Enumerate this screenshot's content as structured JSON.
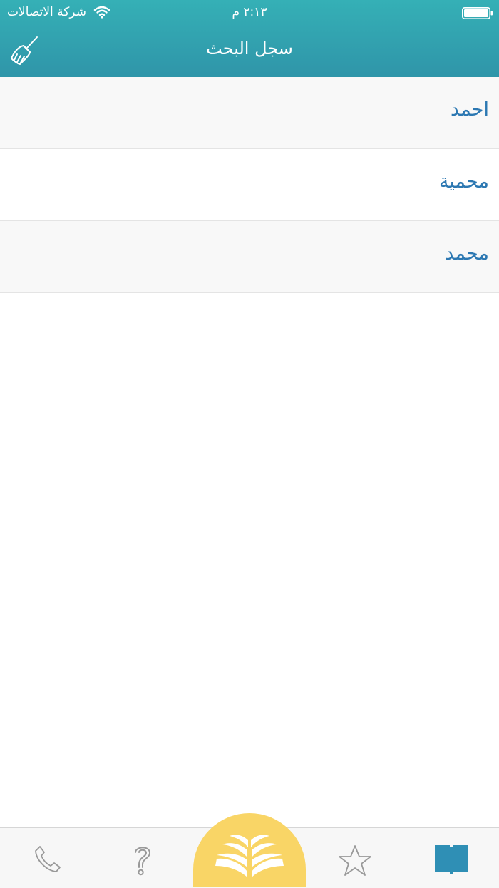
{
  "status_bar": {
    "carrier": "شركة الاتصالات",
    "time": "٢:١٣ م"
  },
  "nav": {
    "title": "سجل البحث",
    "clear_icon": "broom-icon"
  },
  "history": [
    {
      "label": "احمد"
    },
    {
      "label": "محمية"
    },
    {
      "label": "محمد"
    }
  ],
  "tabbar": {
    "tabs": [
      {
        "icon": "phone-icon"
      },
      {
        "icon": "question-icon"
      },
      {
        "icon": "open-book-icon",
        "selected_center": true
      },
      {
        "icon": "star-icon"
      },
      {
        "icon": "book-icon",
        "active": true
      }
    ],
    "colors": {
      "center_bg": "#f9d566",
      "active": "#2f8fb5",
      "inactive": "#999999"
    }
  },
  "colors": {
    "header_top": "#35b0b6",
    "header_bottom": "#2f95a9",
    "link_text": "#2c78b2"
  }
}
